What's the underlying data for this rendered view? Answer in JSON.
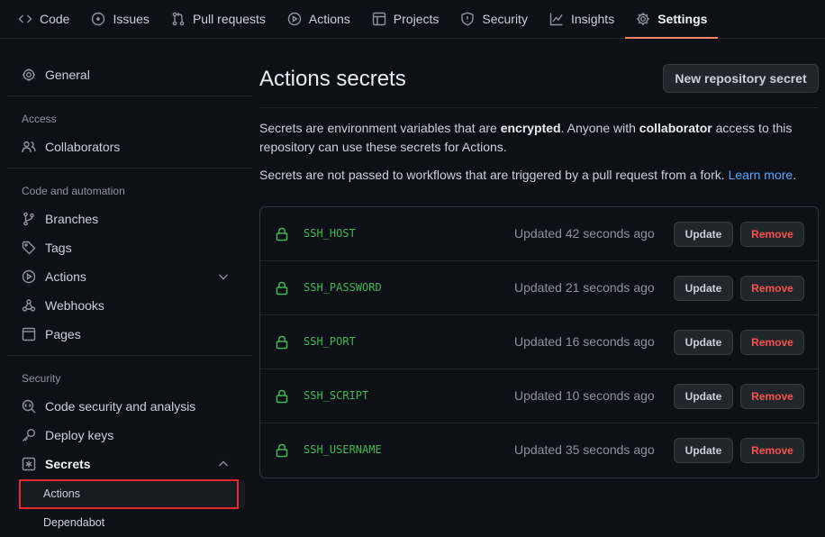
{
  "nav": {
    "tabs": [
      {
        "label": "Code",
        "icon": "code-icon"
      },
      {
        "label": "Issues",
        "icon": "issue-icon"
      },
      {
        "label": "Pull requests",
        "icon": "pull-request-icon"
      },
      {
        "label": "Actions",
        "icon": "play-icon"
      },
      {
        "label": "Projects",
        "icon": "table-icon"
      },
      {
        "label": "Security",
        "icon": "shield-icon"
      },
      {
        "label": "Insights",
        "icon": "graph-icon"
      },
      {
        "label": "Settings",
        "icon": "gear-icon",
        "active": true
      }
    ]
  },
  "sidebar": {
    "general": "General",
    "access_heading": "Access",
    "collaborators": "Collaborators",
    "code_heading": "Code and automation",
    "branches": "Branches",
    "tags": "Tags",
    "actions": "Actions",
    "webhooks": "Webhooks",
    "pages": "Pages",
    "security_heading": "Security",
    "code_security": "Code security and analysis",
    "deploy_keys": "Deploy keys",
    "secrets": "Secrets",
    "secrets_actions": "Actions",
    "secrets_dependabot": "Dependabot"
  },
  "main": {
    "title": "Actions secrets",
    "new_button": "New repository secret",
    "desc1_a": "Secrets are environment variables that are ",
    "desc1_b": "encrypted",
    "desc1_c": ". Anyone with ",
    "desc1_d": "collaborator",
    "desc1_e": " access to this repository can use these secrets for Actions.",
    "desc2_a": "Secrets are not passed to workflows that are triggered by a pull request from a fork. ",
    "desc2_link": "Learn more",
    "desc2_end": ".",
    "update_label": "Update",
    "remove_label": "Remove",
    "secrets": [
      {
        "name": "SSH_HOST",
        "updated": "Updated 42 seconds ago"
      },
      {
        "name": "SSH_PASSWORD",
        "updated": "Updated 21 seconds ago"
      },
      {
        "name": "SSH_PORT",
        "updated": "Updated 16 seconds ago"
      },
      {
        "name": "SSH_SCRIPT",
        "updated": "Updated 10 seconds ago"
      },
      {
        "name": "SSH_USERNAME",
        "updated": "Updated 35 seconds ago"
      }
    ]
  },
  "colors": {
    "accent_underline": "#f78166",
    "secret_green": "#3fb950",
    "remove_red": "#f85149",
    "link_blue": "#58a6ff",
    "highlight_box": "#e5282e"
  }
}
